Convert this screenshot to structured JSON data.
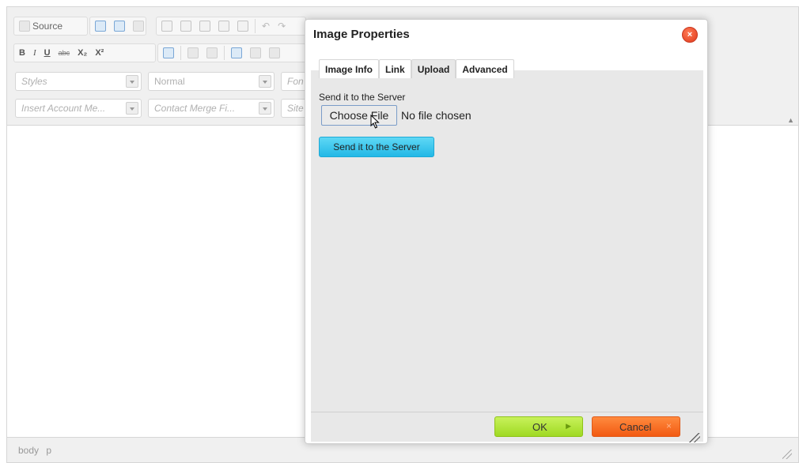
{
  "toolbar": {
    "source_label": "Source",
    "bold": "B",
    "italic": "I",
    "underline": "U",
    "strike": "abc",
    "subscript": "X₂",
    "superscript": "X²",
    "styles_placeholder": "Styles",
    "format_value": "Normal",
    "font_placeholder": "Fon",
    "insert_account_placeholder": "Insert Account Me...",
    "contact_merge_placeholder": "Contact Merge Fi...",
    "site_placeholder": "Site"
  },
  "status_bar": {
    "path": [
      "body",
      "p"
    ]
  },
  "dialog": {
    "title": "Image Properties",
    "close_glyph": "×",
    "tabs": [
      {
        "label": "Image Info",
        "active": false
      },
      {
        "label": "Link",
        "active": false
      },
      {
        "label": "Upload",
        "active": true
      },
      {
        "label": "Advanced",
        "active": false
      }
    ],
    "upload": {
      "field_label": "Send it to the Server",
      "file_button_label": "Choose File",
      "file_status": "No file chosen",
      "send_button_label": "Send it to the Server"
    },
    "footer": {
      "ok_label": "OK",
      "cancel_label": "Cancel"
    }
  },
  "colors": {
    "ok_green": "#9fd923",
    "cancel_orange": "#f25a12",
    "send_cyan": "#22b8e6",
    "close_red": "#e0391b"
  }
}
